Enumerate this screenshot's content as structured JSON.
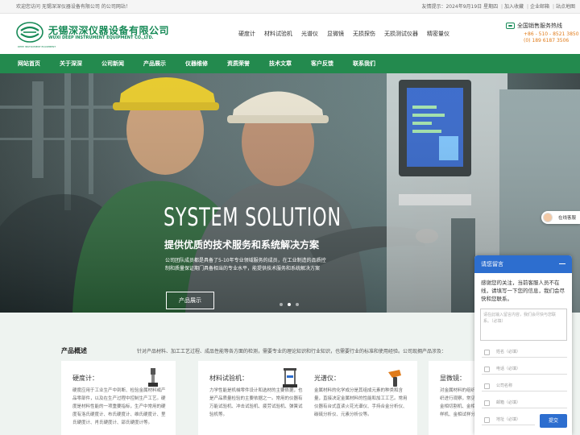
{
  "topbar": {
    "welcome": "欢迎您访问 无锡深深仪器设备有限公司 的公司网站！",
    "tip": "友情提示：2024年9月19日 星期四",
    "links": [
      "加入收藏",
      "企业邮箱",
      "站点地图"
    ]
  },
  "header": {
    "company_name": "无锡深深仪器设备有限公司",
    "company_name_en": "WUXI DEEP INSTRUMENT EQUIPMENT CO.,LTD.",
    "logo_sub": "DEEP INSTRUMENT EQUIPMENT",
    "product_links": [
      "硬度计",
      "材料试验机",
      "光谱仪",
      "显微镜",
      "无损探伤",
      "无损测试仪器",
      "精密量仪"
    ],
    "hotline_title": "全国销售服务热线",
    "phone1": "+86 - 510 - 8521 3850",
    "phone2": "(0) 189 6187 3506"
  },
  "nav": {
    "items": [
      "网站首页",
      "关于深深",
      "公司新闻",
      "产品展示",
      "仪器维修",
      "资质荣誉",
      "技术文章",
      "客户反馈",
      "联系我们"
    ]
  },
  "banner": {
    "headline": "SYSTEM SOLUTION",
    "subhead": "提供优质的技术服务和系统解决方案",
    "desc": "公司团队成员都是具备了5-10年专业领域服务的成员，在工业制造的品质控制和质量保证期门具备相当的专业水平，能提供技术服务和系统解决方案",
    "button": "产品展示",
    "slides": 3,
    "active_slide": 2
  },
  "overview": {
    "title": "产品概述",
    "desc": "针对产品材料、加工工艺过程、成品性能等各方面的检测，需要专业的理论知识和行业知识，也需要行业的标准和使用经验。公司现拥产品涉及：",
    "cards": [
      {
        "title": "硬度计：",
        "text": "硬度应用于工业生产中到断、检验金属材料或产品零部件，以及在生产过程中控制生产工艺。硬度是材料性能的一项重要指标，生产中常用的硬度有洛氏硬度计、布氏硬度计、维氏硬度计、里氏硬度计、肖氏硬度计、邵氏硬度计等。"
      },
      {
        "title": "材料试验机：",
        "text": "力学性能是机械零件设计和选材的主要依据，也是产品质量检验的主要依据之一。常用的仪器有万能试验机、冲击试验机、疲劳试验机、弹簧试验机等。"
      },
      {
        "title": "光谱仪：",
        "text": "金属材料的化学成分是其组成元素的种类和含量，直接决定金属材料的性能和加工工艺。常用仪器有台式直读火花光谱仪、手持合金分析仪、碳硫分析仪、元素分析仪等。"
      },
      {
        "title": "显微镜：",
        "text": "对金属材料的组织观察、分析，需要借助金属组织进行观察，常见的金相显微镜、体视显微镜、金相切割机、金相镶嵌机、金相磨抛机、金相制样机、金相试样分析软件等。"
      }
    ]
  },
  "chat_tab": {
    "label": "在线客服"
  },
  "chat": {
    "title": "请您留言",
    "message": "感谢您的关注，当前客服人员不在线，请填写一下您的信息，我们会尽快和您联系。",
    "textarea_placeholder": "请在此输入留言内容，我们会尽快与您联系。（必填）",
    "fields": [
      "姓名（必填）",
      "电话（必填）",
      "公司名称",
      "邮箱（必填）",
      "地址（必填）"
    ],
    "submit": "提交"
  },
  "colors": {
    "brand_green": "#238a4e",
    "accent_orange": "#e07b1a",
    "chat_blue": "#2d6ecf"
  }
}
